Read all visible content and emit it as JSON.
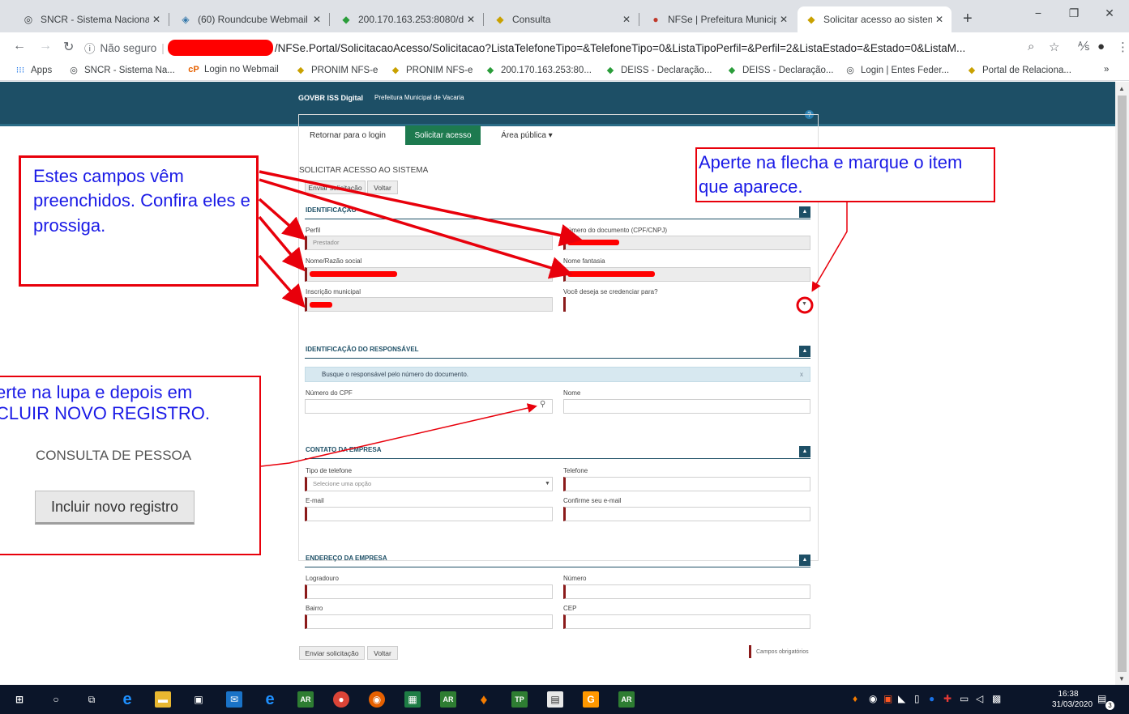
{
  "browser": {
    "tabs": [
      {
        "label": "SNCR - Sistema Nacional",
        "icon": "globe-icon",
        "active": false
      },
      {
        "label": "(60) Roundcube Webmail",
        "icon": "roundcube-icon",
        "active": false
      },
      {
        "label": "200.170.163.253:8080/de",
        "icon": "leaf-icon",
        "active": false
      },
      {
        "label": "Consulta",
        "icon": "diamond-icon",
        "active": false
      },
      {
        "label": "NFSe | Prefeitura Municip",
        "icon": "seal-icon",
        "active": false
      },
      {
        "label": "Solicitar acesso ao sistem",
        "icon": "diamond-icon",
        "active": true
      }
    ],
    "new_tab": "+",
    "window_controls": [
      "−",
      "❐",
      "✕"
    ],
    "address": {
      "security": "Não seguro",
      "url": "/NFSe.Portal/SolicitacaoAcesso/Solicitacao?ListaTelefoneTipo=&TelefoneTipo=0&ListaTipoPerfil=&Perfil=2&ListaEstado=&Estado=0&ListaM..."
    },
    "bookmarks": [
      {
        "label": "Apps",
        "icon": "apps-grid-icon"
      },
      {
        "label": "SNCR - Sistema Na...",
        "icon": "globe-icon"
      },
      {
        "label": "Login no Webmail",
        "icon": "cpanel-icon"
      },
      {
        "label": "PRONIM NFS-e",
        "icon": "diamond-icon"
      },
      {
        "label": "PRONIM NFS-e",
        "icon": "diamond-icon"
      },
      {
        "label": "200.170.163.253:80...",
        "icon": "leaf-icon"
      },
      {
        "label": "DEISS - Declaração...",
        "icon": "leaf-icon"
      },
      {
        "label": "DEISS - Declaração...",
        "icon": "leaf-icon"
      },
      {
        "label": "Login | Entes Feder...",
        "icon": "globe-icon"
      },
      {
        "label": "Portal de Relaciona...",
        "icon": "diamond-icon"
      }
    ],
    "bookmarks_more": "»"
  },
  "header": {
    "brand": "GOVBR ISS Digital",
    "prefeitura": "Prefeitura Municipal de Vacaria",
    "help": "?"
  },
  "nav": {
    "back_login": "Retornar para o login",
    "solicitar": "Solicitar acesso",
    "area_publica": "Área pública ▾"
  },
  "form": {
    "title": "SOLICITAR ACESSO AO SISTEMA",
    "enviar": "Enviar solicitação",
    "voltar": "Voltar",
    "identificacao": {
      "title": "IDENTIFICAÇÃO",
      "perfil_label": "Perfil",
      "perfil_value": "Prestador",
      "numero_doc_label": "Número do documento (CPF/CNPJ)",
      "nome_label": "Nome/Razão social",
      "nome_fantasia_label": "Nome fantasia",
      "inscricao_label": "Inscrição municipal",
      "credenciar_label": "Você deseja se credenciar para?"
    },
    "responsavel": {
      "title": "IDENTIFICAÇÃO DO RESPONSÁVEL",
      "info": "Busque o responsável pelo número do documento.",
      "info_close": "x",
      "cpf_label": "Número do CPF",
      "nome_label": "Nome"
    },
    "contato": {
      "title": "CONTATO DA EMPRESA",
      "tipo_label": "Tipo de telefone",
      "tipo_placeholder": "Selecione uma opção",
      "telefone_label": "Telefone",
      "email_label": "E-mail",
      "confirme_label": "Confirme seu e-mail"
    },
    "endereco": {
      "title": "ENDEREÇO DA EMPRESA",
      "logradouro_label": "Logradouro",
      "numero_label": "Número",
      "bairro_label": "Bairro",
      "cep_label": "CEP"
    },
    "required_note": "Campos obrigatórios"
  },
  "callouts": {
    "left": "Estes campos vêm preenchidos. Confira eles e prossiga.",
    "right": "Aperte na flecha e marque o item que aparece.",
    "lupa_line1": "erte na lupa e depois em",
    "lupa_line2": "CLUIR NOVO REGISTRO.",
    "consulta": "CONSULTA DE PESSOA",
    "incluir": "Incluir novo registro"
  },
  "taskbar": {
    "icons": [
      "windows-start-icon",
      "cortana-circle-icon",
      "task-view-icon",
      "ie-icon",
      "file-explorer-icon",
      "store-icon",
      "mail-icon",
      "edge-icon",
      "ar-app-icon",
      "chrome-icon",
      "firefox-icon",
      "excel-app-icon",
      "ar-app-icon",
      "flame-app-icon",
      "tp-app-icon",
      "document-app-icon",
      "g-app-icon",
      "ar-app-icon"
    ],
    "time": "16:38",
    "date": "31/03/2020",
    "notifications": "3"
  }
}
